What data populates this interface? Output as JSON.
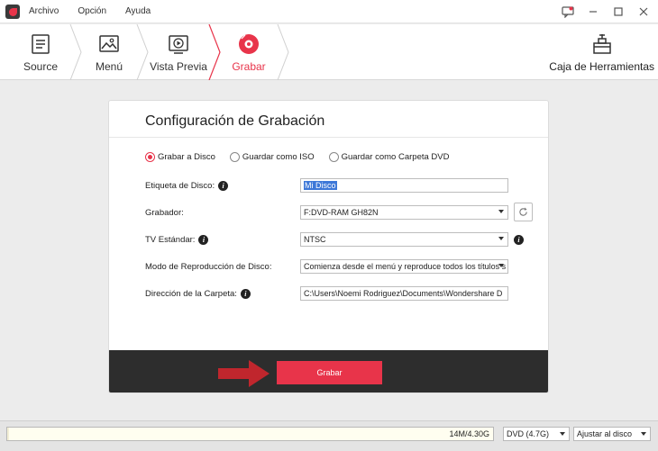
{
  "menu": {
    "items": [
      "Archivo",
      "Opción",
      "Ayuda"
    ]
  },
  "steps": [
    {
      "label": "Source",
      "icon": "document-icon"
    },
    {
      "label": "Menú",
      "icon": "image-icon"
    },
    {
      "label": "Vista Previa",
      "icon": "play-preview-icon"
    },
    {
      "label": "Grabar",
      "icon": "burn-disc-icon",
      "active": true
    }
  ],
  "tools": {
    "label": "Caja de Herramientas",
    "icon": "toolbox-icon"
  },
  "dialog": {
    "title": "Configuración de Grabación",
    "radios": [
      {
        "label": "Grabar a Disco",
        "checked": true
      },
      {
        "label": "Guardar como ISO",
        "checked": false
      },
      {
        "label": "Guardar como Carpeta DVD",
        "checked": false
      }
    ],
    "disc_label": {
      "label": "Etiqueta de Disco:",
      "value": "Mi Disco"
    },
    "burner": {
      "label": "Grabador:",
      "value": "F:DVD-RAM GH82N"
    },
    "tv_standard": {
      "label": "TV Estándar:",
      "value": "NTSC"
    },
    "playback_mode": {
      "label": "Modo de Reproducción de Disco:",
      "value": "Comienza desde el menú y reproduce todos los títulos s"
    },
    "folder_path": {
      "label": "Dirección de la Carpeta:",
      "value": "C:\\Users\\Noemi Rodriguez\\Documents\\Wondershare D"
    },
    "burn_button": "Grabar"
  },
  "bottom": {
    "size_text": "14M/4.30G",
    "size_fraction": 0.003,
    "disc_type": "DVD (4.7G)",
    "fit": "Ajustar al disco"
  },
  "colors": {
    "accent": "#e8344a",
    "footer": "#2d2d2d",
    "arrow": "#c0262d"
  }
}
